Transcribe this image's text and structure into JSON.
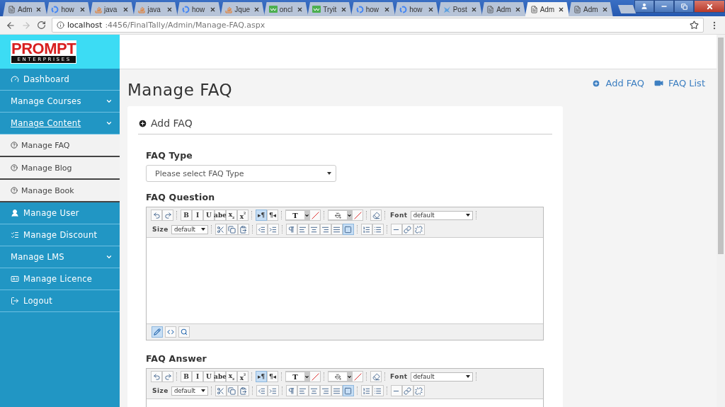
{
  "browser": {
    "tabs": [
      {
        "kind": "page",
        "title": "Adm",
        "selected": false
      },
      {
        "kind": "google",
        "title": "how",
        "selected": false
      },
      {
        "kind": "stack",
        "title": "java",
        "selected": false
      },
      {
        "kind": "stack",
        "title": "java",
        "selected": false
      },
      {
        "kind": "google",
        "title": "how",
        "selected": false
      },
      {
        "kind": "stack",
        "title": "Jque",
        "selected": false
      },
      {
        "kind": "w3",
        "title": "oncl",
        "selected": false
      },
      {
        "kind": "w3",
        "title": "Tryit",
        "selected": false
      },
      {
        "kind": "google",
        "title": "how",
        "selected": false
      },
      {
        "kind": "google",
        "title": "how",
        "selected": false
      },
      {
        "kind": "post",
        "title": "Post",
        "selected": false
      },
      {
        "kind": "page",
        "title": "Adm",
        "selected": false
      },
      {
        "kind": "page",
        "title": "Adm",
        "selected": true
      },
      {
        "kind": "page",
        "title": "Adm",
        "selected": false
      }
    ],
    "address": {
      "host": "localhost",
      "path": ":4456/FinalTally/Admin/Manage-FAQ.aspx"
    }
  },
  "logo": {
    "top": "PROMPT",
    "bottom": "ENTERPRISES"
  },
  "sidebar": {
    "items": [
      {
        "label": "Dashboard",
        "kind": "link",
        "selected": false
      },
      {
        "label": "Manage Courses",
        "kind": "menu",
        "selected": false
      },
      {
        "label": "Manage Content",
        "kind": "menu",
        "selected": true,
        "children": [
          {
            "label": "Manage FAQ"
          },
          {
            "label": "Manage Blog"
          },
          {
            "label": "Manage Book"
          }
        ]
      },
      {
        "label": "Manage User",
        "kind": "link",
        "selected": false
      },
      {
        "label": "Manage Discount",
        "kind": "link",
        "selected": false
      },
      {
        "label": "Manage LMS",
        "kind": "menu",
        "selected": false
      },
      {
        "label": "Manage Licence",
        "kind": "link",
        "selected": false
      },
      {
        "label": "Logout",
        "kind": "link",
        "selected": false
      }
    ]
  },
  "page": {
    "title": "Manage FAQ",
    "actions": [
      {
        "label": "Add FAQ"
      },
      {
        "label": "FAQ List"
      }
    ]
  },
  "form": {
    "heading": "Add FAQ",
    "type_field": {
      "label": "FAQ Type",
      "value": "Please select FAQ Type"
    },
    "editors": [
      {
        "label": "FAQ Question",
        "mode_bar": [
          {
            "selected": true
          },
          {
            "selected": false
          },
          {
            "selected": false
          }
        ],
        "toolbar": [
          {
            "kind": "button",
            "selected": false
          },
          {
            "kind": "button",
            "selected": false
          },
          {
            "kind": "sep"
          },
          {
            "kind": "glyph",
            "text": "B",
            "selected": false
          },
          {
            "kind": "glyph",
            "text": "I",
            "selected": false
          },
          {
            "kind": "glyph",
            "text": "U",
            "selected": false
          },
          {
            "kind": "glyph",
            "text": "abe",
            "selected": false
          },
          {
            "kind": "glyph",
            "text": "x$_{₂}$",
            "selected": false
          },
          {
            "kind": "glyph",
            "text": "x$^{²}$",
            "selected": false
          },
          {
            "kind": "sep"
          },
          {
            "kind": "glyph",
            "text": "▸¶",
            "selected": true
          },
          {
            "kind": "glyph",
            "text": "¶◂",
            "selected": false
          },
          {
            "kind": "sep"
          },
          {
            "kind": "color",
            "text": "T"
          },
          {
            "kind": "button",
            "selected": false
          },
          {
            "kind": "sep"
          },
          {
            "kind": "color"
          },
          {
            "kind": "button",
            "selected": false
          },
          {
            "kind": "sep"
          },
          {
            "kind": "button",
            "selected": false
          },
          {
            "kind": "sep"
          },
          {
            "kind": "label",
            "text": "Font"
          },
          {
            "kind": "select",
            "text": "default",
            "wide": true
          },
          {
            "kind": "sep"
          },
          {
            "kind": "break"
          },
          {
            "kind": "label",
            "text": "Size"
          },
          {
            "kind": "select",
            "text": "default",
            "wide": false
          },
          {
            "kind": "sep"
          },
          {
            "kind": "button",
            "selected": false
          },
          {
            "kind": "button",
            "selected": false
          },
          {
            "kind": "button",
            "selected": false
          },
          {
            "kind": "sep"
          },
          {
            "kind": "button",
            "selected": false
          },
          {
            "kind": "button",
            "selected": false
          },
          {
            "kind": "sep"
          },
          {
            "kind": "button",
            "selected": false
          },
          {
            "kind": "button",
            "selected": false
          },
          {
            "kind": "button",
            "selected": false
          },
          {
            "kind": "button",
            "selected": false
          },
          {
            "kind": "button",
            "selected": false
          },
          {
            "kind": "button",
            "selected": true
          },
          {
            "kind": "sep"
          },
          {
            "kind": "button",
            "selected": false
          },
          {
            "kind": "button",
            "selected": false
          },
          {
            "kind": "sep"
          },
          {
            "kind": "button",
            "selected": false
          },
          {
            "kind": "button",
            "selected": false
          },
          {
            "kind": "button",
            "selected": false
          }
        ]
      },
      {
        "label": "FAQ Answer",
        "toolbar": [
          {
            "kind": "button",
            "selected": false
          },
          {
            "kind": "button",
            "selected": false
          },
          {
            "kind": "sep"
          },
          {
            "kind": "glyph",
            "text": "B",
            "selected": false
          },
          {
            "kind": "glyph",
            "text": "I",
            "selected": false
          },
          {
            "kind": "glyph",
            "text": "U",
            "selected": false
          },
          {
            "kind": "glyph",
            "text": "abe",
            "selected": false
          },
          {
            "kind": "glyph",
            "text": "x$_{₂}$",
            "selected": false
          },
          {
            "kind": "glyph",
            "text": "x$^{²}$",
            "selected": false
          },
          {
            "kind": "sep"
          },
          {
            "kind": "glyph",
            "text": "▸¶",
            "selected": true
          },
          {
            "kind": "glyph",
            "text": "¶◂",
            "selected": false
          },
          {
            "kind": "sep"
          },
          {
            "kind": "color",
            "text": "T"
          },
          {
            "kind": "button",
            "selected": false
          },
          {
            "kind": "sep"
          },
          {
            "kind": "color"
          },
          {
            "kind": "button",
            "selected": false
          },
          {
            "kind": "sep"
          },
          {
            "kind": "button",
            "selected": false
          },
          {
            "kind": "sep"
          },
          {
            "kind": "label",
            "text": "Font"
          },
          {
            "kind": "select",
            "text": "default",
            "wide": true
          },
          {
            "kind": "sep"
          },
          {
            "kind": "break"
          },
          {
            "kind": "label",
            "text": "Size"
          },
          {
            "kind": "select",
            "text": "default",
            "wide": false
          },
          {
            "kind": "sep"
          },
          {
            "kind": "button",
            "selected": false
          },
          {
            "kind": "button",
            "selected": false
          },
          {
            "kind": "button",
            "selected": false
          },
          {
            "kind": "sep"
          },
          {
            "kind": "button",
            "selected": false
          },
          {
            "kind": "button",
            "selected": false
          },
          {
            "kind": "sep"
          },
          {
            "kind": "button",
            "selected": false
          },
          {
            "kind": "button",
            "selected": false
          },
          {
            "kind": "button",
            "selected": false
          },
          {
            "kind": "button",
            "selected": false
          },
          {
            "kind": "button",
            "selected": false
          },
          {
            "kind": "button",
            "selected": true
          },
          {
            "kind": "sep"
          },
          {
            "kind": "button",
            "selected": false
          },
          {
            "kind": "button",
            "selected": false
          },
          {
            "kind": "sep"
          },
          {
            "kind": "button",
            "selected": false
          },
          {
            "kind": "button",
            "selected": false
          },
          {
            "kind": "button",
            "selected": false
          }
        ]
      }
    ]
  }
}
